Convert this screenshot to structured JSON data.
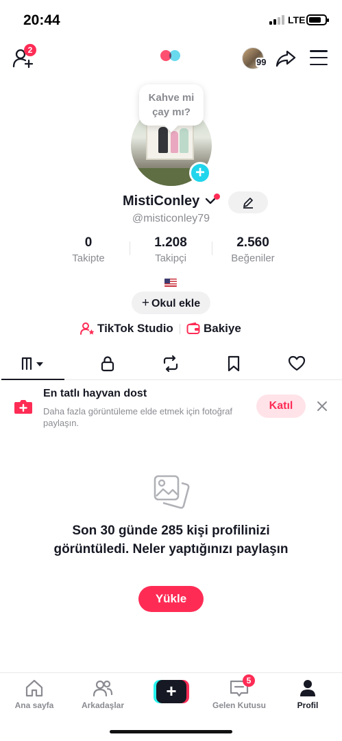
{
  "status": {
    "time": "20:44",
    "network": "LTE",
    "battery_level": 0.75
  },
  "topnav": {
    "friend_requests_badge": "2",
    "story_count": "99"
  },
  "profile": {
    "bubble_text_line1": "Kahve mi",
    "bubble_text_line2": "çay mı?",
    "display_name": "MistiConley",
    "username": "@misticonley79",
    "stats": [
      {
        "value": "0",
        "label": "Takipte"
      },
      {
        "value": "1.208",
        "label": "Takipçi"
      },
      {
        "value": "2.560",
        "label": "Beğeniler"
      }
    ],
    "add_school_label": "Okul ekle",
    "add_school_plus": "+",
    "studio_label": "TikTok Studio",
    "balance_label": "Bakiye"
  },
  "tabs": [
    "videos-grid-icon",
    "lock-icon",
    "repost-icon",
    "bookmark-icon",
    "heart-icon"
  ],
  "promo": {
    "title": "En tatlı hayvan dost",
    "description": "Daha fazla görüntüleme elde etmek için fotoğraf paylaşın.",
    "join_label": "Katıl"
  },
  "empty_state": {
    "message": "Son 30 günde 285 kişi profilinizi görüntüledi. Neler yaptığınızı paylaşın",
    "upload_label": "Yükle"
  },
  "bottom_nav": {
    "home": "Ana sayfa",
    "friends": "Arkadaşlar",
    "create": "+",
    "inbox": "Gelen Kutusu",
    "inbox_badge": "5",
    "profile": "Profil"
  },
  "colors": {
    "accent": "#fe2c55",
    "cyan": "#25f4ee",
    "text": "#161823",
    "muted": "#8a8b91"
  }
}
